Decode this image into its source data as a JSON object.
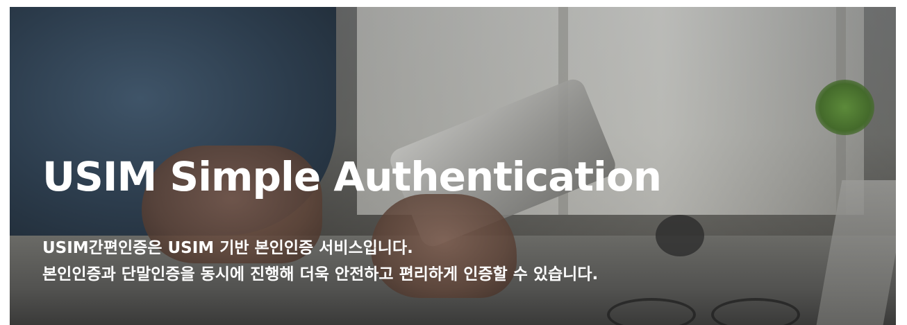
{
  "hero": {
    "title": "USIM Simple Authentication",
    "description_lines": [
      "USIM간편인증은 USIM 기반 본인인증 서비스입니다.",
      "본인인증과 단말인증을 동시에 진행해 더욱 안전하고 편리하게 인증할 수 있습니다."
    ]
  },
  "colors": {
    "text": "#ffffff",
    "page_background": "#ffffff",
    "overlay": "#000000"
  }
}
